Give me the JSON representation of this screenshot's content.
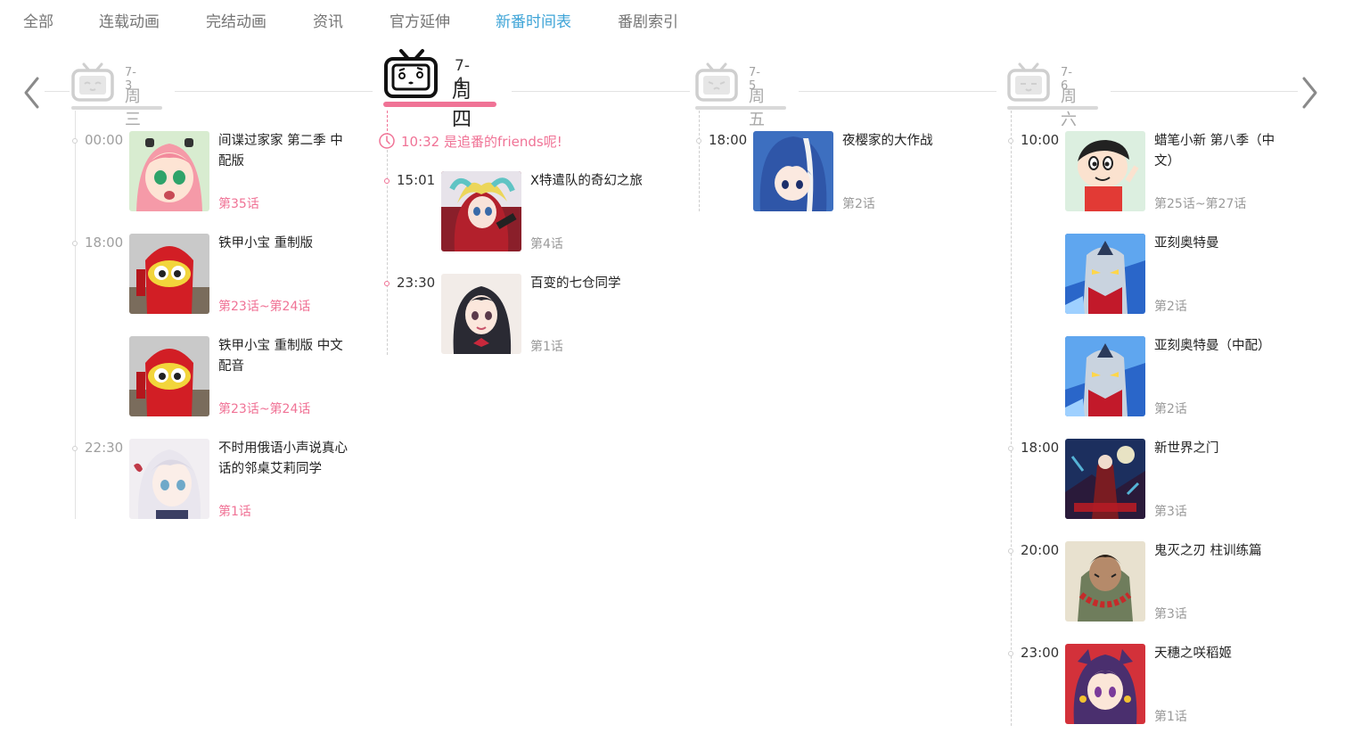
{
  "nav": {
    "tabs": [
      {
        "label": "全部",
        "active": false
      },
      {
        "label": "连载动画",
        "active": false
      },
      {
        "label": "完结动画",
        "active": false
      },
      {
        "label": "资讯",
        "active": false
      },
      {
        "label": "官方延伸",
        "active": false
      },
      {
        "label": "新番时间表",
        "active": true
      },
      {
        "label": "番剧索引",
        "active": false
      }
    ]
  },
  "colors": {
    "accent_pink": "#f07396",
    "active_tab_blue": "#3ea4d7",
    "muted_text": "#9a9a9a"
  },
  "arrows": {
    "prev_icon": "chevron-left-icon",
    "next_icon": "chevron-right-icon"
  },
  "days": [
    {
      "date": "7-3",
      "weekday": "周三",
      "is_today": false,
      "items": [
        {
          "time": "00:00",
          "title": "间谍过家家 第二季 中配版",
          "episode": "第35话",
          "episode_highlight": true
        },
        {
          "time": "18:00",
          "title": "铁甲小宝 重制版",
          "episode": "第23话~第24话",
          "episode_highlight": true
        },
        {
          "time": "",
          "title": "铁甲小宝 重制版 中文配音",
          "episode": "第23话~第24话",
          "episode_highlight": true
        },
        {
          "time": "22:30",
          "title": "不时用俄语小声说真心话的邻桌艾莉同学",
          "episode": "第1话",
          "episode_highlight": true
        }
      ]
    },
    {
      "date": "7-4",
      "weekday": "周四",
      "is_today": true,
      "now_time": "10:32",
      "now_text": "是追番的friends呢!",
      "items": [
        {
          "time": "15:01",
          "title": "X特遣队的奇幻之旅",
          "episode": "第4话",
          "episode_highlight": false
        },
        {
          "time": "23:30",
          "title": "百变的七仓同学",
          "episode": "第1话",
          "episode_highlight": false
        }
      ]
    },
    {
      "date": "7-5",
      "weekday": "周五",
      "is_today": false,
      "items": [
        {
          "time": "18:00",
          "title": "夜樱家的大作战",
          "episode": "第2话",
          "episode_highlight": false
        }
      ]
    },
    {
      "date": "7-6",
      "weekday": "周六",
      "is_today": false,
      "items": [
        {
          "time": "10:00",
          "title": "蜡笔小新 第八季（中文）",
          "episode": "第25话~第27话",
          "episode_highlight": false
        },
        {
          "time": "",
          "title": "亚刻奥特曼",
          "episode": "第2话",
          "episode_highlight": false
        },
        {
          "time": "",
          "title": "亚刻奥特曼（中配）",
          "episode": "第2话",
          "episode_highlight": false
        },
        {
          "time": "18:00",
          "title": "新世界之门",
          "episode": "第3话",
          "episode_highlight": false
        },
        {
          "time": "20:00",
          "title": "鬼灭之刃 柱训练篇",
          "episode": "第3话",
          "episode_highlight": false
        },
        {
          "time": "23:00",
          "title": "天穗之咲稻姬",
          "episode": "第1话",
          "episode_highlight": false
        }
      ]
    }
  ]
}
